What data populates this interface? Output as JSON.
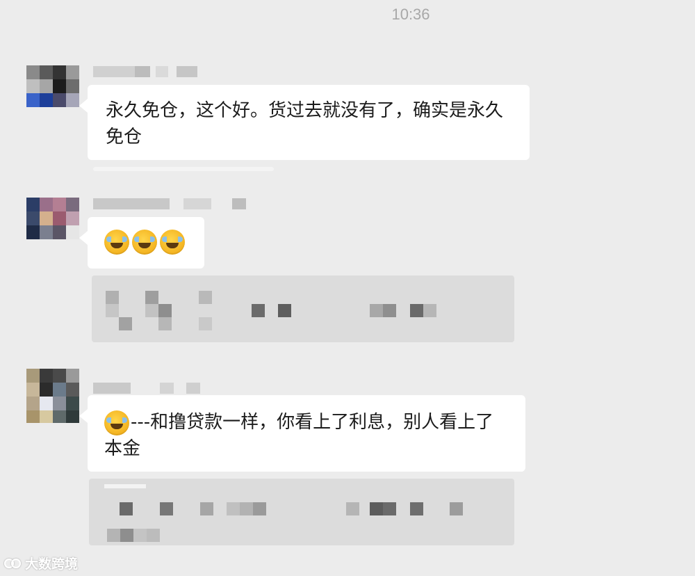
{
  "chat": {
    "timestamp": "10:36",
    "messages": [
      {
        "sender_avatar": "avatar-1",
        "text": "永久免仓，这个好。货过去就没有了，确实是永久免仓",
        "emojis": []
      },
      {
        "sender_avatar": "avatar-2",
        "text": "",
        "emojis": [
          "face-with-tears-of-joy",
          "face-with-tears-of-joy",
          "face-with-tears-of-joy"
        ]
      },
      {
        "sender_avatar": "avatar-3",
        "text": "---和撸贷款一样，你看上了利息，别人看上了本金",
        "emojis": [
          "face-with-tears-of-joy"
        ]
      }
    ]
  },
  "watermark": {
    "text": "大数跨境"
  },
  "colors": {
    "background": "#ececec",
    "bubble": "#ffffff",
    "card": "#dcdcdc",
    "timestamp": "#a8a8a8"
  }
}
